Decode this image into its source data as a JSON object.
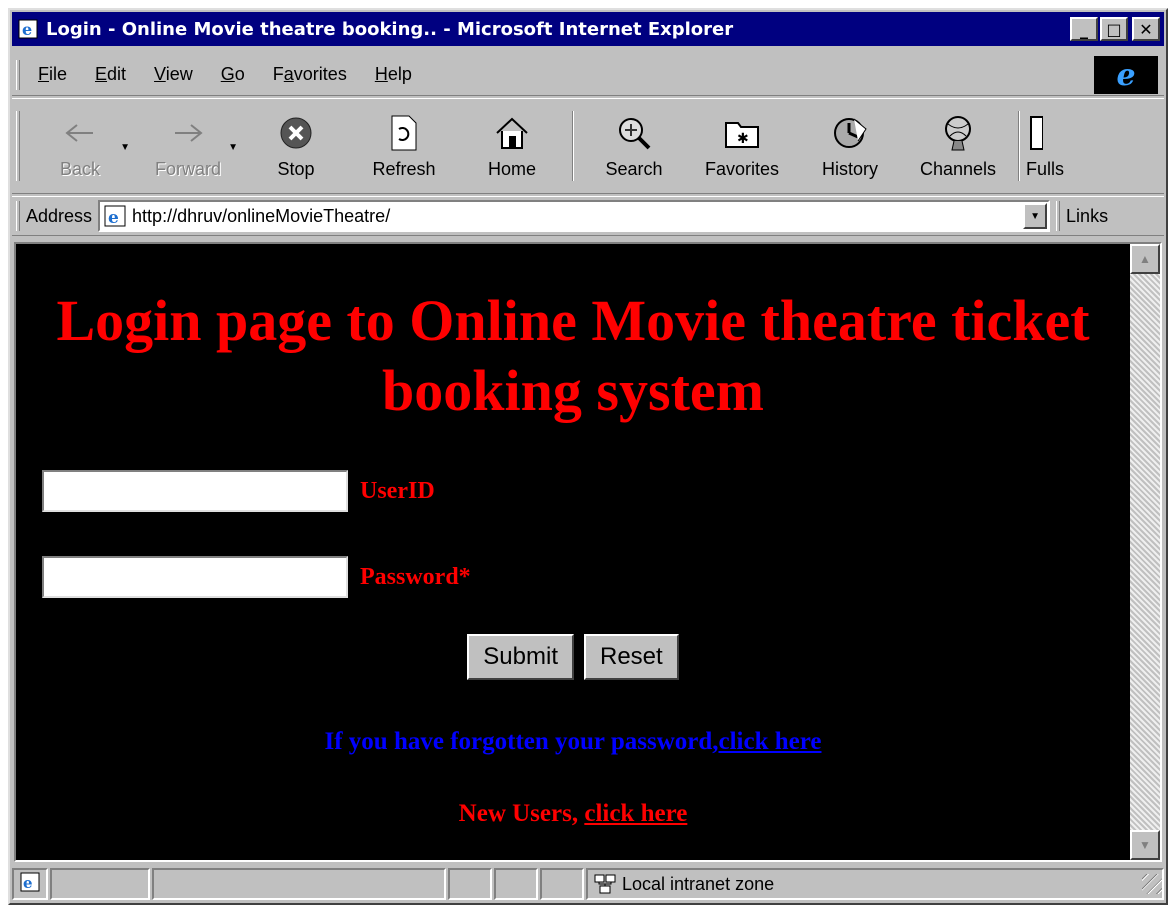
{
  "window": {
    "title": "Login - Online Movie theatre booking.. - Microsoft Internet Explorer",
    "minimize": "_",
    "maximize": "□",
    "close": "✕"
  },
  "menu": {
    "items": [
      {
        "hotkey": "F",
        "rest": "ile"
      },
      {
        "hotkey": "E",
        "rest": "dit"
      },
      {
        "hotkey": "V",
        "rest": "iew"
      },
      {
        "hotkey": "G",
        "rest": "o"
      },
      {
        "pre": "F",
        "hotkey": "a",
        "rest": "vorites"
      },
      {
        "hotkey": "H",
        "rest": "elp"
      }
    ],
    "logo_glyph": "e"
  },
  "toolbar": {
    "back": "Back",
    "forward": "Forward",
    "stop": "Stop",
    "refresh": "Refresh",
    "home": "Home",
    "search": "Search",
    "favorites": "Favorites",
    "history": "History",
    "channels": "Channels",
    "fullscreen": "Fulls"
  },
  "address": {
    "label": "Address",
    "url": "http://dhruv/onlineMovieTheatre/",
    "links": "Links"
  },
  "page": {
    "heading": "Login page to Online Movie theatre ticket booking system",
    "userid_label": "UserID",
    "userid_value": "",
    "password_label": "Password*",
    "password_value": "",
    "submit": "Submit",
    "reset": "Reset",
    "forgot_text": "If you have forgotten your password,",
    "forgot_link": "click here",
    "new_users_text": "New Users, ",
    "new_users_link": "click here"
  },
  "status": {
    "zone": "Local intranet zone"
  },
  "colors": {
    "page_background": "#000000",
    "heading": "#ff0000",
    "labels": "#ff0000",
    "forgot_link": "#0000ff",
    "titlebar": "#000080"
  },
  "icons": [
    "ie-page-icon",
    "back-arrow-icon",
    "forward-arrow-icon",
    "stop-icon",
    "refresh-icon",
    "home-icon",
    "search-icon",
    "favorites-icon",
    "history-icon",
    "channels-icon",
    "fullscreen-icon",
    "intranet-zone-icon"
  ]
}
